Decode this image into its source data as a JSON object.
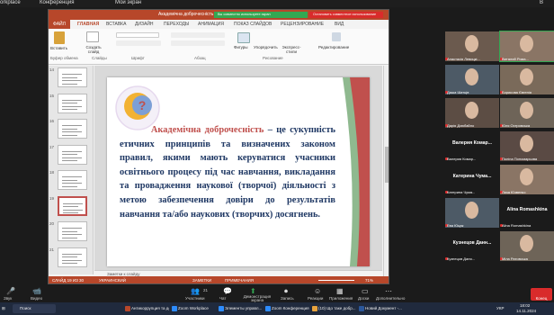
{
  "zoom_top": {
    "left_text": "orkplace",
    "app_label": "Конференция",
    "middle_label": "Мой экран",
    "sub_label": "В"
  },
  "ppt": {
    "title": "Академічна доброчесність - PowerPoint",
    "share_banner": "Вы совместно используете экран",
    "stop_share": "Остановить совместное использование",
    "tabs": [
      "ФАЙЛ",
      "ГЛАВНАЯ",
      "ВСТАВКА",
      "ДИЗАЙН",
      "ПЕРЕХОДЫ",
      "АНИМАЦИЯ",
      "ПОКАЗ СЛАЙДОВ",
      "РЕЦЕНЗИРОВАНИЕ",
      "ВИД"
    ],
    "ribbon": {
      "paste": "Вставить",
      "create_slide": "Создать слайд",
      "shapes": "Фигуры",
      "arrange": "Упорядочить",
      "quick_styles": "Экспресс-стили",
      "editing": "Редактирование",
      "groups": [
        "Буфер обмена",
        "Слайды",
        "Шрифт",
        "Абзац",
        "Рисование"
      ]
    },
    "thumb_numbers": [
      "14",
      "15",
      "16",
      "17",
      "18",
      "19",
      "20",
      "21"
    ],
    "slide": {
      "term": "Академічна доброчесність",
      "body": " – це сукупність етичних принципів та визначених законом правил, якими мають керуватися учасники освітнього процесу під час навчання, викладання та провадження наукової (творчої) діяльності з метою забезпечення довіри до результатів навчання та/або наукових (творчих) досягнень."
    },
    "notes": "Заметки к слайду",
    "status": {
      "slide_count": "СЛАЙД 19 ИЗ 30",
      "language": "УКРАИНСКИЙ",
      "notes": "ЗАМЕТКИ",
      "comments": "ПРИМЕЧАНИЯ",
      "zoom": "71%"
    }
  },
  "participants": [
    {
      "name": "Анастасія Левицкі..."
    },
    {
      "name": "Виталий Рома..."
    },
    {
      "name": "Даша Шатців"
    },
    {
      "name": "Борисова Євгенія"
    },
    {
      "name": "Дарія Дзюбайло"
    },
    {
      "name": "Юля Островська"
    },
    {
      "name": "Валерия Комар...",
      "big": "Валерия Комар..."
    },
    {
      "name": "Поліна Пономарьова"
    },
    {
      "name": "Катерина Чума...",
      "big": "Катерина Чума..."
    },
    {
      "name": "Лиза Юзвенко"
    },
    {
      "name": "Ева Юцак"
    },
    {
      "name": "Alina Romashkina",
      "big": "Alina Romashkina"
    },
    {
      "name": "Кузнецов Даня...",
      "big": "Кузнецов Данн..."
    },
    {
      "name": "Мiла Ратовська"
    }
  ],
  "zoom_controls": {
    "mute": "Звук",
    "video": "Видео",
    "participants": "Участники",
    "count": "21",
    "chat": "Чат",
    "share": "Демонстрация экрана",
    "record": "Запись",
    "reactions": "Реакции",
    "apps": "Приложения",
    "whiteboards": "Доски",
    "more": "Дополнительно",
    "end": "Конец"
  },
  "taskbar": {
    "search": "Поиск",
    "items": [
      "Антикоррупция та дo...",
      "Zoom Workplace",
      "Элементы управл...",
      "Zoom Конференция",
      "(10) Що таке добр...",
      "Новий Документ -..."
    ],
    "time": "18:02",
    "date": "14.11.2024",
    "lang": "УКР"
  }
}
